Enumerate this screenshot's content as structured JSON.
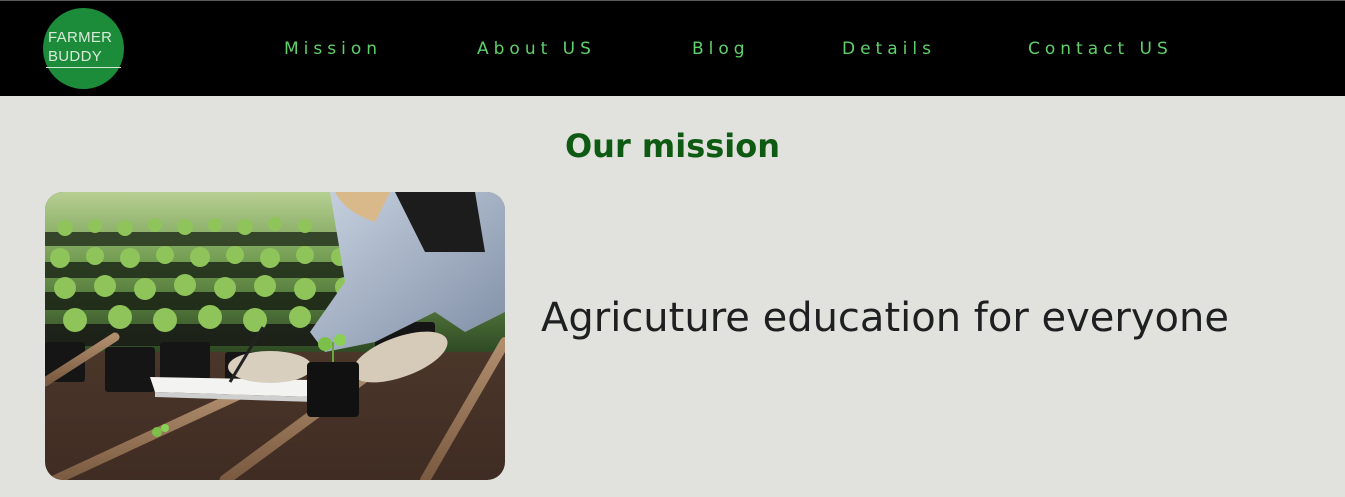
{
  "header": {
    "logo": {
      "line1": "FARMER",
      "line2": "BUDDY",
      "color": "#1c8c3a"
    },
    "nav": [
      {
        "label": "Mission"
      },
      {
        "label": "About US"
      },
      {
        "label": "Blog"
      },
      {
        "label": "Details"
      },
      {
        "label": "Contact US"
      }
    ],
    "nav_color": "#5fd16a",
    "background": "#000000"
  },
  "mission": {
    "title": "Our mission",
    "tagline": "Agricuture education for everyone",
    "title_color": "#0e5a12"
  },
  "page": {
    "background": "#e1e2dd"
  }
}
